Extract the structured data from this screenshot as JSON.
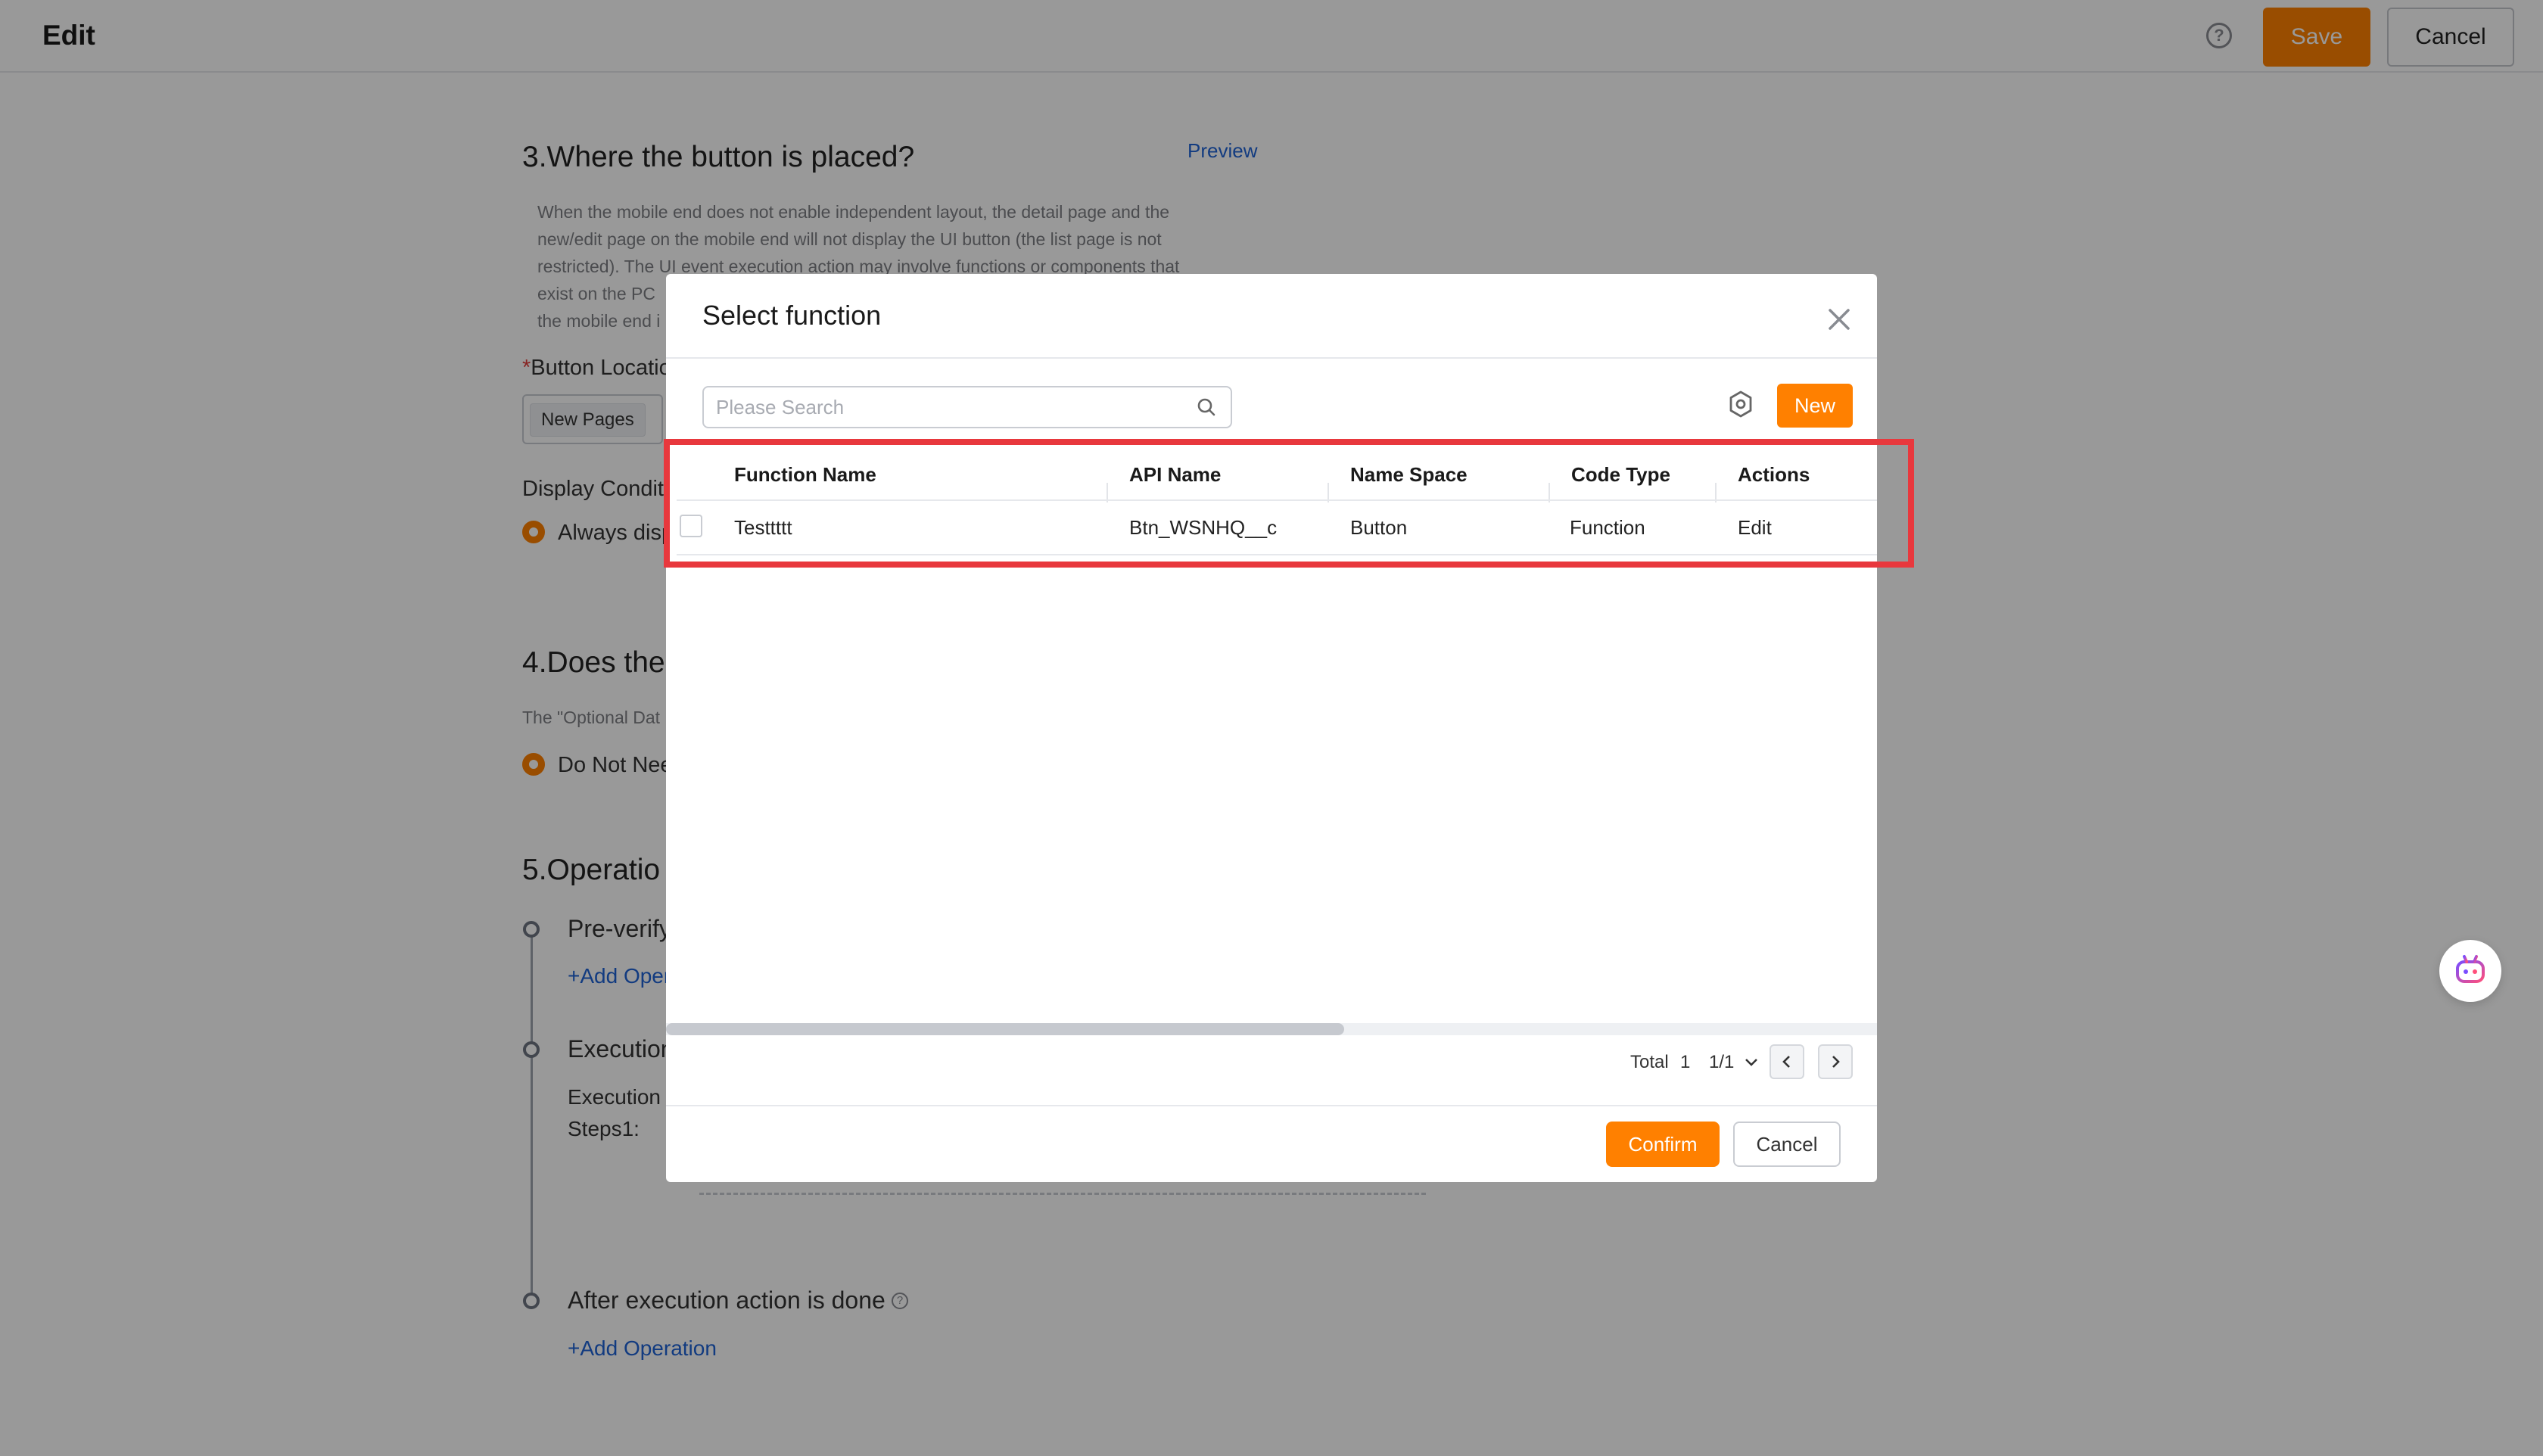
{
  "header": {
    "title": "Edit",
    "help_icon": "question-circle-icon",
    "save_label": "Save",
    "cancel_label": "Cancel"
  },
  "section3": {
    "title": "3.Where the button is placed?",
    "preview_label": "Preview",
    "desc_lines": [
      "When the mobile end does not enable independent layout, the detail page and the",
      "new/edit page on the mobile end will not display the UI button (the list page is not",
      "restricted). The UI event execution action may involve functions or components that",
      "exist on the PC",
      "the mobile end i"
    ],
    "button_location_label": "Button Locatio",
    "location_tag": "New Pages",
    "display_condition_label": "Display Conditi",
    "display_radio_label": "Always disp"
  },
  "section4": {
    "title": "4.Does the",
    "desc": "The \"Optional Dat",
    "radio_label": "Do Not Nee"
  },
  "section5": {
    "title": "5.Operatio",
    "steps": {
      "pre_verify": "Pre-verify",
      "pre_verify_add": "+Add Oper",
      "execution": "Execution",
      "execution_sub1": "Execution",
      "execution_sub2": "Steps1:",
      "after": "After execution action is done",
      "after_add": "+Add Operation"
    }
  },
  "assistant": {
    "icon": "robot-assistant-icon"
  },
  "modal": {
    "title": "Select function",
    "close_icon": "close-icon",
    "search": {
      "placeholder": "Please Search",
      "value": ""
    },
    "new_label": "New",
    "table": {
      "headers": {
        "function_name": "Function Name",
        "api_name": "API Name",
        "name_space": "Name Space",
        "code_type": "Code Type",
        "actions": "Actions"
      },
      "rows": [
        {
          "function_name": "Testtttt",
          "api_name": "Btn_WSNHQ__c",
          "name_space": "Button",
          "code_type": "Function",
          "action": "Edit"
        }
      ]
    },
    "pagination": {
      "total_label": "Total",
      "total_value": "1",
      "page": "1/1"
    },
    "horizontal_scroll_fraction": 0.56,
    "confirm_label": "Confirm",
    "cancel_label": "Cancel"
  },
  "colors": {
    "accent": "#ff8000",
    "link": "#1f63d6",
    "highlight": "#e8383d"
  }
}
